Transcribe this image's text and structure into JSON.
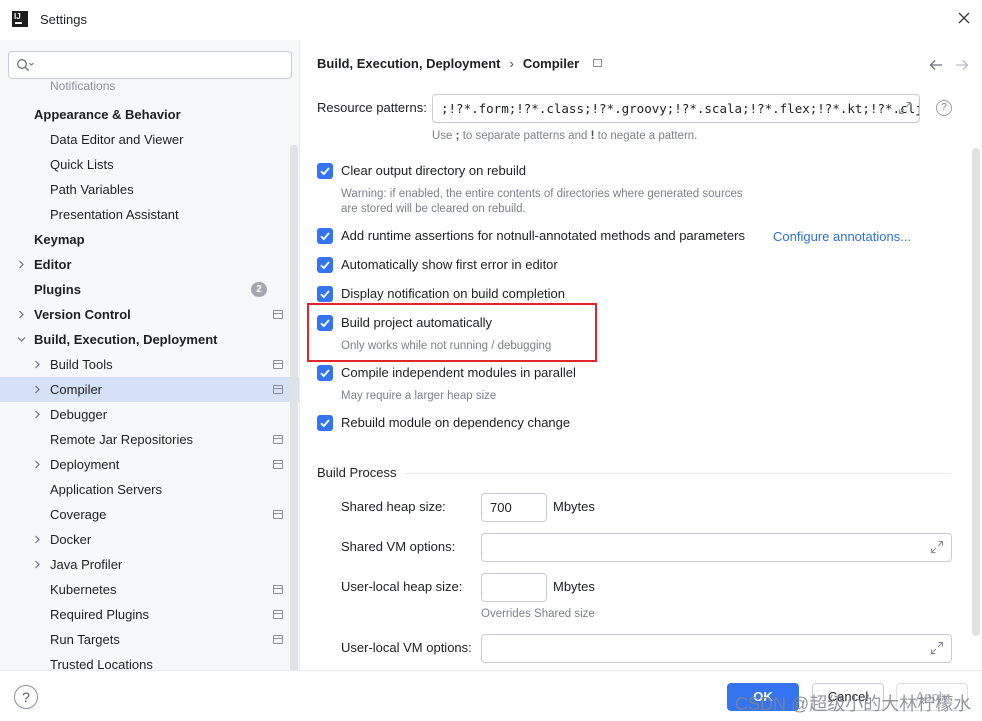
{
  "window": {
    "title": "Settings"
  },
  "search": {
    "placeholder": ""
  },
  "sidebar": {
    "items": [
      {
        "label": "Notifications",
        "indent": 2,
        "bold": false,
        "chevron": "",
        "proj": false,
        "partial": true
      },
      {
        "label": "Appearance & Behavior",
        "indent": 1,
        "bold": true,
        "chevron": "",
        "proj": false
      },
      {
        "label": "Data Editor and Viewer",
        "indent": 2,
        "bold": false,
        "chevron": "",
        "proj": false
      },
      {
        "label": "Quick Lists",
        "indent": 2,
        "bold": false,
        "chevron": "",
        "proj": false
      },
      {
        "label": "Path Variables",
        "indent": 2,
        "bold": false,
        "chevron": "",
        "proj": false
      },
      {
        "label": "Presentation Assistant",
        "indent": 2,
        "bold": false,
        "chevron": "",
        "proj": false
      },
      {
        "label": "Keymap",
        "indent": 1,
        "bold": true,
        "chevron": "",
        "proj": false
      },
      {
        "label": "Editor",
        "indent": 1,
        "bold": true,
        "chevron": "right",
        "proj": false
      },
      {
        "label": "Plugins",
        "indent": 1,
        "bold": true,
        "chevron": "",
        "proj": false,
        "badge": "2"
      },
      {
        "label": "Version Control",
        "indent": 1,
        "bold": true,
        "chevron": "right",
        "proj": true
      },
      {
        "label": "Build, Execution, Deployment",
        "indent": 1,
        "bold": true,
        "chevron": "down",
        "proj": false
      },
      {
        "label": "Build Tools",
        "indent": 2,
        "bold": false,
        "chevron": "right",
        "proj": true
      },
      {
        "label": "Compiler",
        "indent": 2,
        "bold": false,
        "chevron": "right",
        "proj": true,
        "selected": true
      },
      {
        "label": "Debugger",
        "indent": 2,
        "bold": false,
        "chevron": "right",
        "proj": false
      },
      {
        "label": "Remote Jar Repositories",
        "indent": 2,
        "bold": false,
        "chevron": "",
        "proj": true
      },
      {
        "label": "Deployment",
        "indent": 2,
        "bold": false,
        "chevron": "right",
        "proj": true
      },
      {
        "label": "Application Servers",
        "indent": 2,
        "bold": false,
        "chevron": "",
        "proj": false
      },
      {
        "label": "Coverage",
        "indent": 2,
        "bold": false,
        "chevron": "",
        "proj": true
      },
      {
        "label": "Docker",
        "indent": 2,
        "bold": false,
        "chevron": "right",
        "proj": false
      },
      {
        "label": "Java Profiler",
        "indent": 2,
        "bold": false,
        "chevron": "right",
        "proj": false
      },
      {
        "label": "Kubernetes",
        "indent": 2,
        "bold": false,
        "chevron": "",
        "proj": true
      },
      {
        "label": "Required Plugins",
        "indent": 2,
        "bold": false,
        "chevron": "",
        "proj": true
      },
      {
        "label": "Run Targets",
        "indent": 2,
        "bold": false,
        "chevron": "",
        "proj": true
      },
      {
        "label": "Trusted Locations",
        "indent": 2,
        "bold": false,
        "chevron": "",
        "proj": false
      }
    ]
  },
  "breadcrumb": {
    "parent": "Build, Execution, Deployment",
    "sep": "›",
    "current": "Compiler"
  },
  "resource": {
    "label": "Resource patterns:",
    "value": ";!?*.form;!?*.class;!?*.groovy;!?*.scala;!?*.flex;!?*.kt;!?*.clj;",
    "hint_use": "Use",
    "hint_semi": ";",
    "hint_mid": "to separate patterns and",
    "hint_bang": "!",
    "hint_end": "to negate a pattern.",
    "help": "?"
  },
  "options": {
    "clear_output": {
      "label": "Clear output directory on rebuild",
      "checked": true
    },
    "clear_warning_1": "Warning: if enabled, the entire contents of directories where generated sources",
    "clear_warning_2": "are stored will be cleared on rebuild.",
    "runtime_assert": {
      "label": "Add runtime assertions for notnull-annotated methods and parameters",
      "checked": true
    },
    "configure_link": "Configure annotations...",
    "show_first_error": {
      "label": "Automatically show first error in editor",
      "checked": true
    },
    "notify_completion": {
      "label": "Display notification on build completion",
      "checked": true
    },
    "build_auto": {
      "label": "Build project automatically",
      "checked": true
    },
    "build_auto_hint": "Only works while not running / debugging",
    "parallel": {
      "label": "Compile independent modules in parallel",
      "checked": true
    },
    "parallel_hint": "May require a larger heap size",
    "rebuild_dep": {
      "label": "Rebuild module on dependency change",
      "checked": true
    }
  },
  "build_process": {
    "title": "Build Process",
    "shared_heap_label": "Shared heap size:",
    "shared_heap_value": "700",
    "mbytes": "Mbytes",
    "shared_vm_label": "Shared VM options:",
    "shared_vm_value": "",
    "user_heap_label": "User-local heap size:",
    "user_heap_value": "",
    "user_heap_hint": "Overrides Shared size",
    "user_vm_label": "User-local VM options:",
    "user_vm_value": ""
  },
  "footer": {
    "help": "?",
    "ok": "OK",
    "cancel": "Cancel",
    "apply": "Apply"
  },
  "watermark": "CSDN @超级小的大林柠檬水",
  "colors": {
    "accent": "#3574f0",
    "selection": "#d5e1f6",
    "highlight": "#e0262a",
    "link": "#2f6fd8"
  }
}
